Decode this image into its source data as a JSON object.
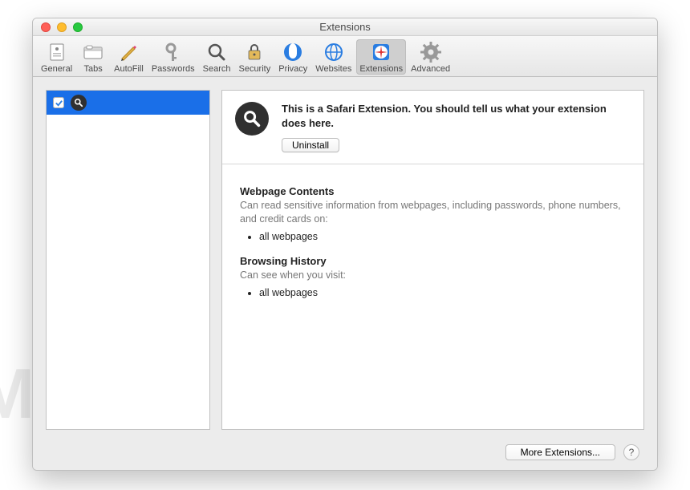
{
  "window": {
    "title": "Extensions"
  },
  "toolbar": {
    "items": [
      {
        "label": "General"
      },
      {
        "label": "Tabs"
      },
      {
        "label": "AutoFill"
      },
      {
        "label": "Passwords"
      },
      {
        "label": "Search"
      },
      {
        "label": "Security"
      },
      {
        "label": "Privacy"
      },
      {
        "label": "Websites"
      },
      {
        "label": "Extensions"
      },
      {
        "label": "Advanced"
      }
    ]
  },
  "sidebar": {
    "items": [
      {
        "checked": true
      }
    ]
  },
  "detail": {
    "description": "This is a Safari Extension. You should tell us what your extension does here.",
    "uninstall_label": "Uninstall"
  },
  "permissions": {
    "webpage_contents": {
      "heading": "Webpage Contents",
      "text": "Can read sensitive information from webpages, including passwords, phone numbers, and credit cards on:",
      "items": [
        "all webpages"
      ]
    },
    "browsing_history": {
      "heading": "Browsing History",
      "text": "Can see when you visit:",
      "items": [
        "all webpages"
      ]
    }
  },
  "footer": {
    "more_extensions_label": "More Extensions...",
    "help_label": "?"
  },
  "watermark": "MALWARETIPS"
}
